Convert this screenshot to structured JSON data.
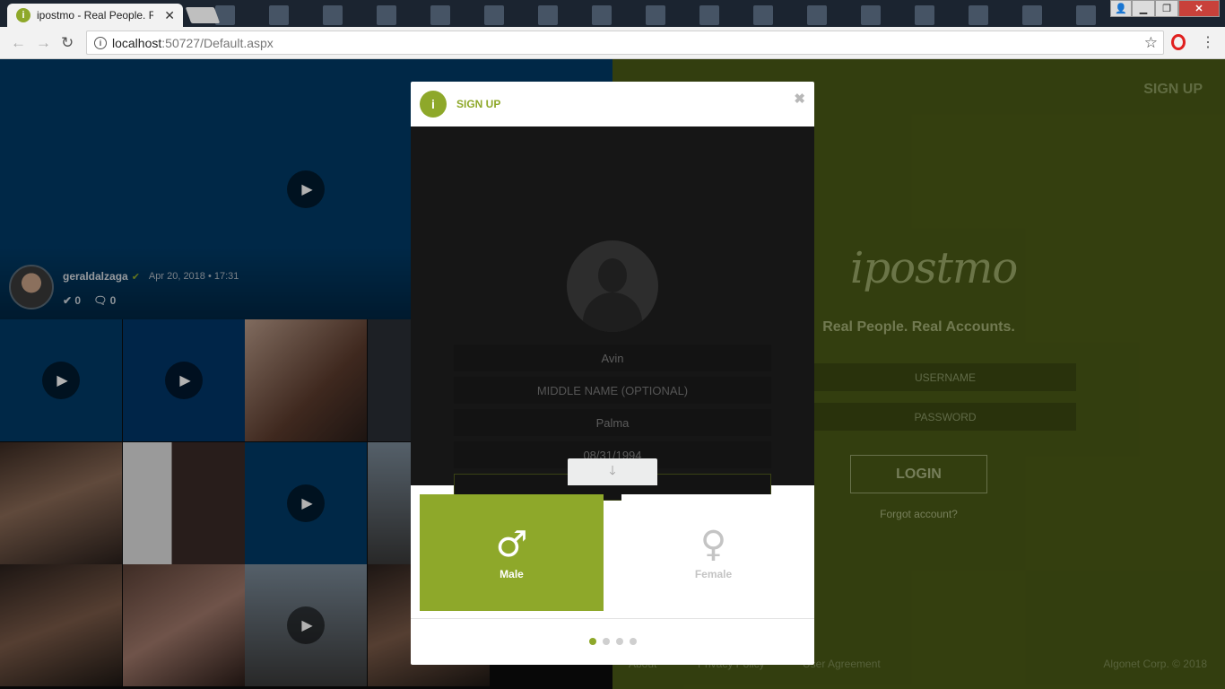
{
  "browser": {
    "tab_title": "ipostmo - Real People. Re",
    "tab_close": "✕",
    "favicon_letter": "i",
    "url_host": "localhost",
    "url_rest": ":50727/Default.aspx",
    "icons": {
      "back": "back-arrow-icon",
      "forward": "forward-arrow-icon",
      "reload": "reload-icon",
      "star": "star-icon",
      "opera": "opera-icon",
      "menu": "kebab-menu-icon"
    }
  },
  "feature_post": {
    "username": "geraldalzaga",
    "date": "Apr 20, 2018 • 17:31",
    "likes": "0",
    "comments": "0"
  },
  "right_panel": {
    "signup_link": "SIGN UP",
    "logo": "ipostmo",
    "tagline": "Real People. Real Accounts.",
    "username_placeholder": "USERNAME",
    "password_placeholder": "PASSWORD",
    "login_label": "LOGIN",
    "forgot_label": "Forgot account?",
    "footer": {
      "about": "About",
      "privacy": "Privacy Policy",
      "agreement": "User Agreement",
      "copyright": "Algonet Corp. © 2018"
    }
  },
  "modal": {
    "title": "SIGN UP",
    "close": "✖",
    "fields": {
      "first_name": "Avin",
      "middle_name_placeholder": "MIDDLE NAME (OPTIONAL)",
      "last_name": "Palma",
      "birthdate": "08/31/1994"
    },
    "gender": {
      "male_label": "Male",
      "female_label": "Female",
      "selected": "Male"
    },
    "steps": {
      "total": 4,
      "current": 1
    }
  },
  "colors": {
    "accent": "#8ea82a",
    "feature_blue": "#003a66",
    "right_bg": "#4a5a16"
  }
}
